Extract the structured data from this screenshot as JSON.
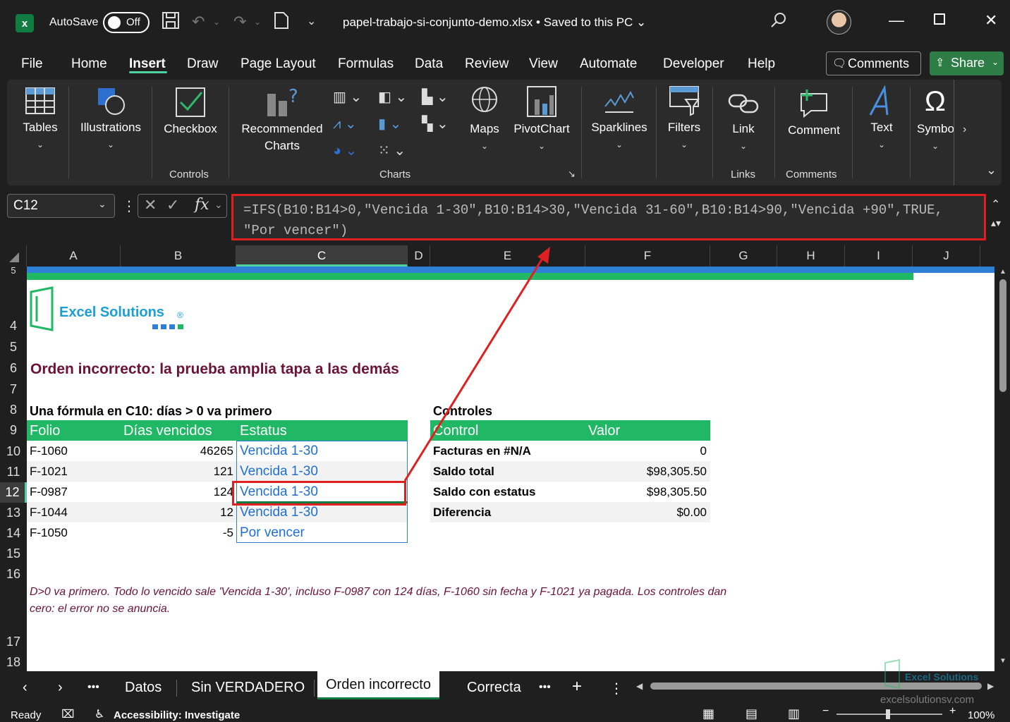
{
  "titlebar": {
    "autosave_label": "AutoSave",
    "autosave_state": "Off",
    "document_title": "papel-trabajo-si-conjunto-demo.xlsx • Saved to this PC ⌄"
  },
  "menu": {
    "tabs": [
      "File",
      "Home",
      "Insert",
      "Draw",
      "Page Layout",
      "Formulas",
      "Data",
      "Review",
      "View",
      "Automate",
      "Developer",
      "Help"
    ],
    "comments_label": "Comments",
    "share_label": "Share"
  },
  "ribbon": {
    "tables": "Tables",
    "illustrations": "Illustrations",
    "checkbox": "Checkbox",
    "controls_group": "Controls",
    "recommended_charts_1": "Recommended",
    "recommended_charts_2": "Charts",
    "charts_group": "Charts",
    "maps": "Maps",
    "pivotchart": "PivotChart",
    "sparklines": "Sparklines",
    "filters": "Filters",
    "link": "Link",
    "links_group": "Links",
    "comment": "Comment",
    "comments_group": "Comments",
    "text": "Text",
    "symbols": "Symbo"
  },
  "formula_bar": {
    "name_box": "C12",
    "fx": "fx",
    "formula_line1": "=IFS(B10:B14>0,\"Vencida 1-30\",B10:B14>30,\"Vencida 31-60\",B10:B14>90,\"Vencida +90\",TRUE,",
    "formula_line2": "\"Por vencer\")"
  },
  "columns": [
    "A",
    "B",
    "C",
    "D",
    "E",
    "F",
    "G",
    "H",
    "I",
    "J"
  ],
  "rows": [
    "5",
    "4",
    "5",
    "6",
    "7",
    "8",
    "9",
    "10",
    "11",
    "12",
    "13",
    "14",
    "15",
    "16",
    "17",
    "18"
  ],
  "sheet": {
    "logo_text": "Excel Solutions",
    "logo_reg": "®",
    "title": "Orden incorrecto: la prueba amplia tapa a las demás",
    "left_subtitle": "Una fórmula en C10: días > 0 va primero",
    "right_subtitle": "Controles",
    "left_headers": [
      "Folio",
      "Días vencidos",
      "Estatus"
    ],
    "left_rows": [
      {
        "folio": "F-1060",
        "dias": "46265",
        "estatus": "Vencida 1-30"
      },
      {
        "folio": "F-1021",
        "dias": "121",
        "estatus": "Vencida 1-30"
      },
      {
        "folio": "F-0987",
        "dias": "124",
        "estatus": "Vencida 1-30"
      },
      {
        "folio": "F-1044",
        "dias": "12",
        "estatus": "Vencida 1-30"
      },
      {
        "folio": "F-1050",
        "dias": "-5",
        "estatus": "Por vencer"
      }
    ],
    "right_headers": [
      "Control",
      "Valor"
    ],
    "right_rows": [
      {
        "control": "Facturas en #N/A",
        "valor": "0"
      },
      {
        "control": "Saldo total",
        "valor": "$98,305.50"
      },
      {
        "control": "Saldo con estatus",
        "valor": "$98,305.50"
      },
      {
        "control": "Diferencia",
        "valor": "$0.00"
      }
    ],
    "note_line1": "D>0 va primero. Todo lo vencido sale 'Vencida 1-30', incluso F-0987 con 124 días, F-1060 sin fecha y F-1021 ya pagada. Los controles dan",
    "note_line2": "cero: el error no se anuncia."
  },
  "tabs": {
    "sheets": [
      "Datos",
      "Sin VERDADERO",
      "Orden incorrecto",
      "Correcta"
    ],
    "active": "Orden incorrecto"
  },
  "watermark": {
    "brand": "Excel Solutions",
    "url": "excelsolutionsv.com"
  },
  "status": {
    "ready": "Ready",
    "accessibility": "Accessibility: Investigate",
    "zoom": "100%"
  },
  "colors": {
    "accent_green": "#21b865",
    "title_maroon": "#6b1239",
    "status_blue": "#1f6fd1",
    "highlight_red": "#e02020"
  }
}
